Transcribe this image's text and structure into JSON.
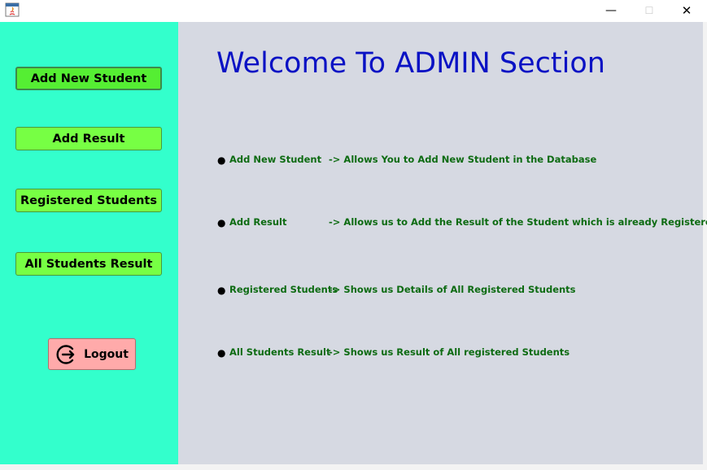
{
  "window": {
    "minimize_glyph": "—",
    "maximize_glyph": "☐",
    "close_glyph": "✕"
  },
  "sidebar": {
    "buttons": [
      {
        "label": "Add New Student"
      },
      {
        "label": "Add Result"
      },
      {
        "label": "Registered Students"
      },
      {
        "label": "All Students Result"
      }
    ],
    "logout": {
      "label": "Logout",
      "icon": "logout-icon"
    }
  },
  "main": {
    "title": "Welcome To ADMIN Section",
    "items": [
      {
        "name": "Add New Student",
        "description": "-> Allows You to Add New Student in the Database"
      },
      {
        "name": "Add Result",
        "description": "-> Allows us to Add the Result of the Student which is already Registered"
      },
      {
        "name": "Registered Students",
        "description": "-> Shows us Details of All Registered Students"
      },
      {
        "name": "All Students Result",
        "description": "-> Shows us Result of All registered Students"
      }
    ]
  },
  "colors": {
    "sidebar_bg": "#33ffcc",
    "content_bg": "#d6d9e2",
    "button_bg": "#77ff44",
    "logout_bg": "#ffaaaa",
    "title_color": "#0a12c4",
    "item_text_color": "#0d6b12"
  }
}
